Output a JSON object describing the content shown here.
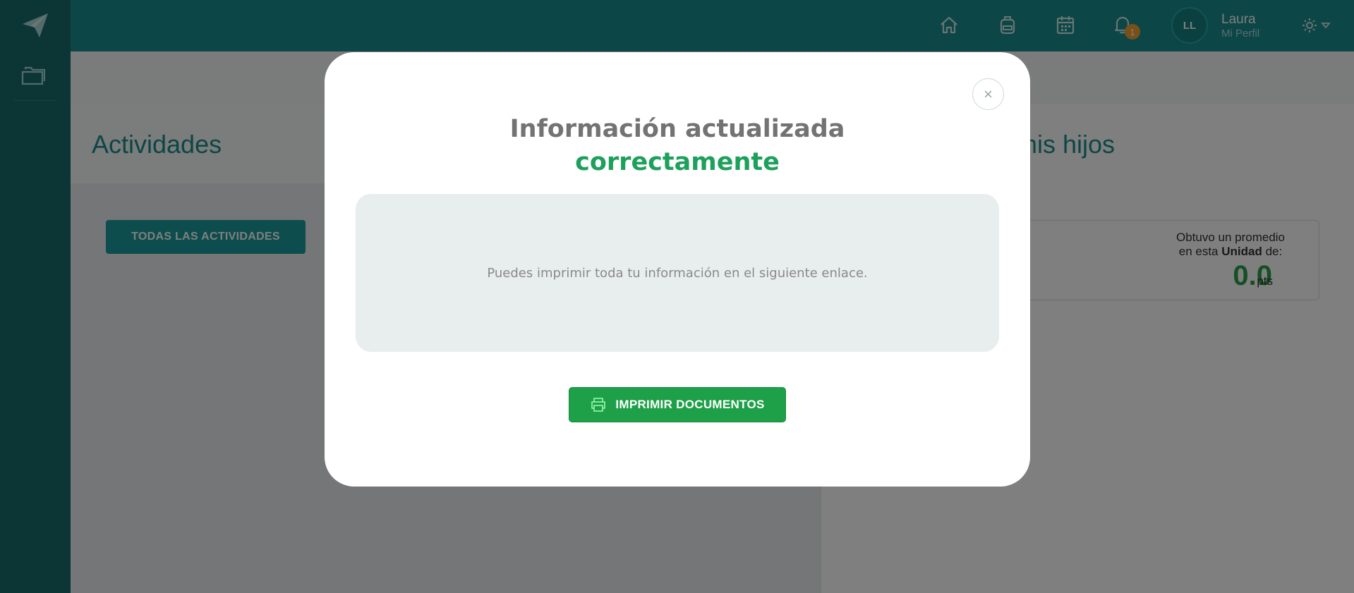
{
  "colors": {
    "sidebar": "#186d6d",
    "topbar": "#1b8d8d",
    "accent_teal": "#1b9b9b",
    "success_green": "#1ea05d",
    "button_green": "#1ea048",
    "badge_orange": "#f0a030"
  },
  "sidebar": {
    "logo_icon": "paper-plane-icon",
    "items": [
      {
        "icon": "folder-icon"
      }
    ]
  },
  "topbar": {
    "icons": [
      "home-icon",
      "backpack-icon",
      "calendar-icon",
      "bell-icon"
    ],
    "notification_count": "1",
    "user": {
      "initials": "LL",
      "name": "Laura",
      "profile_link": "Mi Perfil"
    },
    "settings_icon": "gear-icon"
  },
  "background": {
    "left_title": "Actividades",
    "right_title": "mis hijos",
    "all_activities_button": "TODAS LAS ACTIVIDADES",
    "average_card": {
      "line1": "Obtuvo un promedio",
      "line2_prefix": "en esta",
      "line2_bold": "Unidad",
      "line2_suffix": "de:",
      "value": "0.0",
      "unit": "pts"
    }
  },
  "modal": {
    "close_label": "×",
    "title": "Información actualizada",
    "subtitle": "correctamente",
    "message": "Puedes imprimir toda tu información en el siguiente enlace.",
    "print_button": "IMPRIMIR DOCUMENTOS",
    "print_icon": "printer-icon"
  }
}
